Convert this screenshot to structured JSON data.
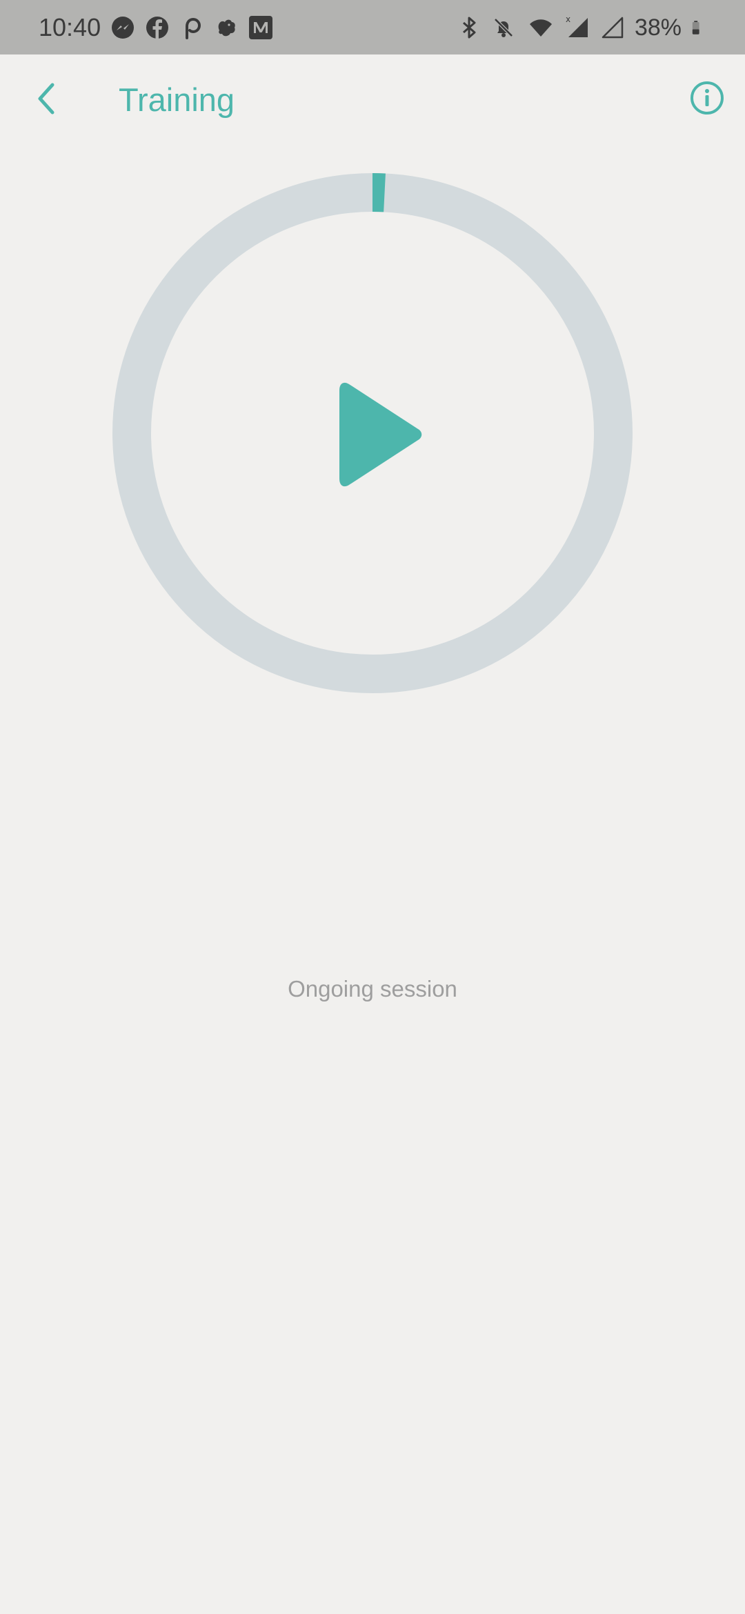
{
  "status_bar": {
    "time": "10:40",
    "left_icons": [
      "messenger-icon",
      "facebook-icon",
      "pocketcasts-icon",
      "squirrel-icon",
      "medium-icon"
    ],
    "right_icons": [
      "bluetooth-icon",
      "notifications-off-icon",
      "wifi-icon",
      "signal-icon",
      "signal-empty-icon"
    ],
    "battery_percent": "38%"
  },
  "app_bar": {
    "title": "Training",
    "back_icon": "chevron-left-icon",
    "info_icon": "info-icon"
  },
  "progress": {
    "fraction": 0.008,
    "track_color": "#d3dadd",
    "fill_color": "#4db6ac"
  },
  "play_icon": "play-icon",
  "session_label": "Ongoing session",
  "colors": {
    "accent": "#4db6ac",
    "background": "#f1f0ee",
    "status_bar": "#b3b3b1"
  }
}
